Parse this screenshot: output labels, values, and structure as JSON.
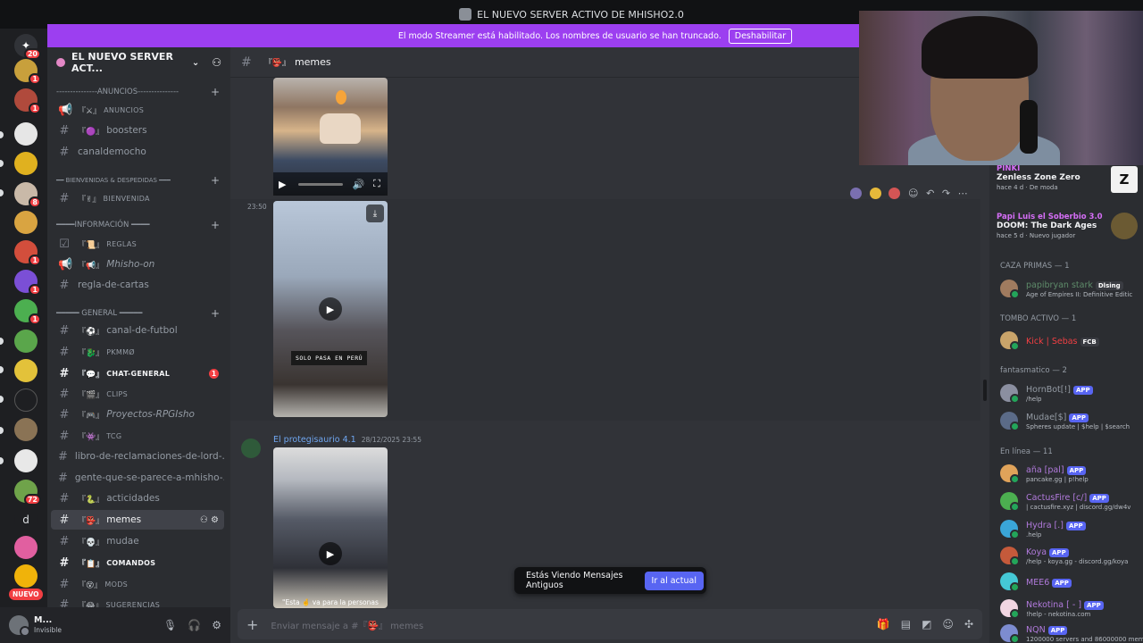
{
  "window": {
    "title": "EL NUEVO SERVER ACTIVO DE MHISHO2.0"
  },
  "banner": {
    "text": "El modo Streamer está habilitado. Los nombres de usuario se han truncado.",
    "button": "Deshabilitar"
  },
  "guilds": {
    "home_badge": "20",
    "badges": [
      "1",
      "1",
      "8",
      "1",
      "1",
      "1",
      "72"
    ],
    "letter": "d",
    "nuevo": "NUEVO"
  },
  "server": {
    "name": "EL NUEVO SERVER ACT..."
  },
  "categories": {
    "anuncios": "---------------ANUNCIOS---------------",
    "bienvenidas": "━━ BIENVENIDAS & DESPEDIDAS ━━━",
    "informacion": "━━━━INFORMACIÓN ━━━━",
    "general": "━━━━━ GENERAL ━━━━━"
  },
  "channels": [
    {
      "emo": "『⚔』",
      "label": "ANUNCIOS"
    },
    {
      "emo": "『🟣』",
      "label": "boosters"
    },
    {
      "emo": "",
      "label": "canaldemocho"
    },
    {
      "emo": "『✌』",
      "label": "BIENVENIDA"
    },
    {
      "emo": "『📜』",
      "label": "REGLAS"
    },
    {
      "emo": "『📢』",
      "label": "Mhisho-on"
    },
    {
      "emo": "",
      "label": "regla-de-cartas"
    },
    {
      "emo": "『⚽』",
      "label": "canal-de-futbol"
    },
    {
      "emo": "『🐉』",
      "label": "PKMMØ"
    },
    {
      "emo": "『💬』",
      "label": "CHAT-GENERAL",
      "unread": "1"
    },
    {
      "emo": "『🎬』",
      "label": "CLIPS"
    },
    {
      "emo": "『🎮』",
      "label": "Proyectos-RPGIsho"
    },
    {
      "emo": "『👾』",
      "label": "TCG"
    },
    {
      "emo": "",
      "label": "libro-de-reclamaciones-de-lord-..."
    },
    {
      "emo": "",
      "label": "gente-que-se-parece-a-mhisho-..."
    },
    {
      "emo": "『🐍』",
      "label": "acticidades"
    },
    {
      "emo": "『👺』",
      "label": "memes"
    },
    {
      "emo": "『💀』",
      "label": "mudae"
    },
    {
      "emo": "『📋』",
      "label": "COMANDOS"
    },
    {
      "emo": "『😵』",
      "label": "MODS"
    },
    {
      "emo": "『😂』",
      "label": "SUGERENCIAS"
    }
  ],
  "user": {
    "name": "M...",
    "status": "Invisible"
  },
  "channel_header": {
    "emo": "『👺』",
    "name": "memes"
  },
  "messages": {
    "time": "23:50",
    "caption": "SOLO PASA EN PERÚ",
    "author": "El protegisaurio 4.1",
    "date": "28/12/2025 23:55",
    "subtitle": "\"Esta 🤞 va para la personas"
  },
  "old_messages": {
    "label": "Estás Viendo Mensajes Antiguos",
    "button": "Ir al actual"
  },
  "composer": {
    "placeholder": "Enviar mensaje a #『👺』 memes"
  },
  "members": {
    "activities": [
      {
        "user": "PINKI",
        "title": "Zenless Zone Zero",
        "meta": "hace 4 d  ·  De moda"
      },
      {
        "user": "Papi Luis el Soberbio 3.0",
        "title": "DOOM: The Dark Ages",
        "meta": "hace 5 d  ·  Nuevo jugador"
      }
    ],
    "groups": [
      {
        "label": "CAZA PRIMAS — 1",
        "members": [
          {
            "name": "papibryan stark",
            "tag": "Dlsing",
            "sub": "Age of Empires II: Definitive Editic",
            "color": "#5e8c6a"
          }
        ]
      },
      {
        "label": "TOMBO ACTIVO — 1",
        "members": [
          {
            "name": "Kick | Sebas",
            "tag": "FCB",
            "sub": "",
            "color": "#f23f43"
          }
        ]
      },
      {
        "label": "fantasmatico — 2",
        "members": [
          {
            "name": "HornBot[!]",
            "tag": "APP",
            "sub": "/help",
            "color": "#949ba4"
          },
          {
            "name": "Mudae[$]",
            "tag": "APP",
            "sub": "Spheres update | $help | $search",
            "color": "#949ba4"
          }
        ]
      },
      {
        "label": "En línea — 11",
        "members": [
          {
            "name": "aña [pal]",
            "tag": "APP",
            "sub": "pancake.gg | p!help",
            "color": "#b17adc"
          },
          {
            "name": "CactusFire [c/]",
            "tag": "APP",
            "sub": "| cactusfire.xyz | discord.gg/dw4v",
            "color": "#b17adc"
          },
          {
            "name": "Hydra [.]",
            "tag": "APP",
            "sub": ".help",
            "color": "#b17adc"
          },
          {
            "name": "Koya",
            "tag": "APP",
            "sub": "/help - koya.gg - discord.gg/koya",
            "color": "#b17adc"
          },
          {
            "name": "MEE6",
            "tag": "APP",
            "sub": "",
            "color": "#b17adc"
          },
          {
            "name": "Nekotina [ - ]",
            "tag": "APP",
            "sub": "!help - nekotina.com",
            "color": "#b17adc"
          },
          {
            "name": "NQN",
            "tag": "APP",
            "sub": "1200000 servers and 86000000 mem",
            "color": "#b17adc"
          }
        ]
      }
    ]
  }
}
